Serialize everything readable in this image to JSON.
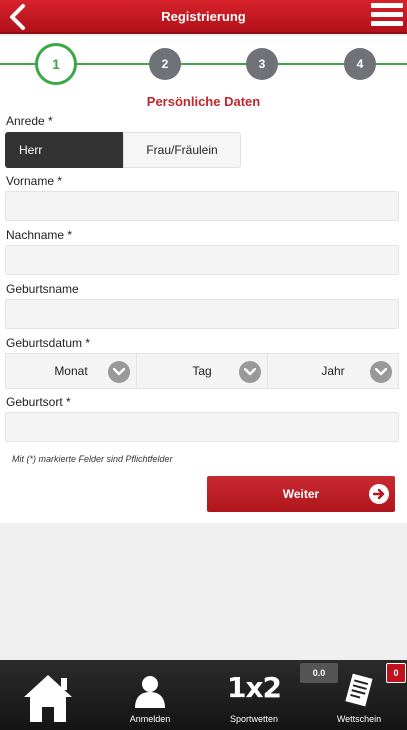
{
  "header": {
    "title": "Registrierung",
    "back_icon": "chevron-left-icon",
    "menu_icon": "hamburger-icon"
  },
  "steps": [
    "1",
    "2",
    "3",
    "4"
  ],
  "section_title": "Persönliche Daten",
  "salutation": {
    "label": "Anrede *",
    "options": [
      "Herr",
      "Frau/Fräulein"
    ],
    "selected": "Herr"
  },
  "fields": {
    "vorname": {
      "label": "Vorname *",
      "value": ""
    },
    "nachname": {
      "label": "Nachname *",
      "value": ""
    },
    "geburtsname": {
      "label": "Geburtsname",
      "value": ""
    },
    "geburtsort": {
      "label": "Geburtsort *",
      "value": ""
    }
  },
  "birthdate": {
    "label": "Geburtsdatum *",
    "month": "Monat",
    "day": "Tag",
    "year": "Jahr"
  },
  "hint": "Mit (*) markierte Felder sind Pflichtfelder",
  "continue_label": "Weiter",
  "nav": {
    "home_icon": "home-icon",
    "login_label": "Anmelden",
    "sports_logo": "1x2",
    "sports_label": "Sportwetten",
    "betslip_label": "Wettschein",
    "balance": "0.0",
    "betslip_count": "0"
  },
  "colors": {
    "brand_red": "#c0272d",
    "step_green": "#3aa845",
    "step_gray": "#6f7276"
  }
}
